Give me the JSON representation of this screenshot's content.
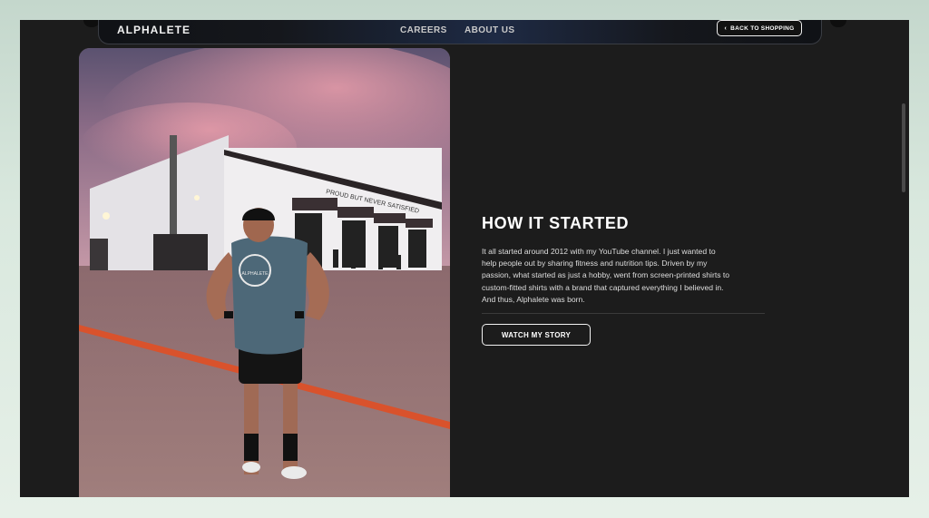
{
  "header": {
    "brand": "ALPHALETE",
    "nav": [
      {
        "label": "CAREERS"
      },
      {
        "label": "ABOUT US"
      }
    ],
    "back_button": {
      "label": "BACK TO SHOPPING",
      "icon": "chevron-left-icon"
    }
  },
  "hero": {
    "building_sign": "PROUD BUT NEVER SATISFIED",
    "shirt_logo": "ALPHALETE"
  },
  "story": {
    "title": "HOW IT STARTED",
    "body": "It all started around 2012 with my YouTube channel. I just wanted to help people out by sharing fitness and nutrition tips. Driven by my passion, what started as just a hobby, went from screen-printed shirts to custom-fitted shirts with a brand that captured everything I believed in. And thus, Alphalete was born.",
    "cta": "WATCH MY STORY"
  },
  "colors": {
    "page_bg": "#1c1c1c",
    "text": "#ffffff",
    "accent_line": "#d9522c"
  }
}
